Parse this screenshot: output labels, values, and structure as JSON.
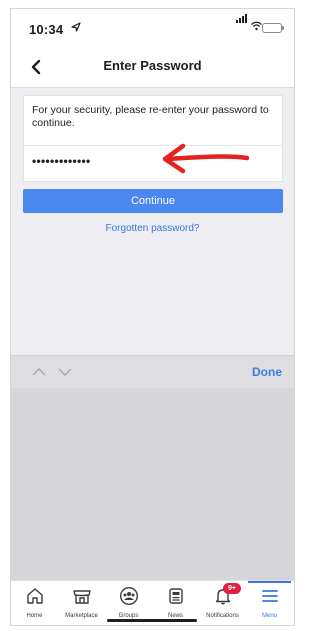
{
  "status_bar": {
    "time": "10:34"
  },
  "navbar": {
    "title": "Enter Password"
  },
  "form": {
    "message": "For your security, please re-enter your password to continue.",
    "password_value": "•••••••••••••",
    "continue_label": "Continue",
    "forgot_label": "Forgotten password?"
  },
  "keyboard_toolbar": {
    "done_label": "Done"
  },
  "tabbar": {
    "tabs": [
      {
        "label": "Home",
        "icon": "home-icon"
      },
      {
        "label": "Marketplace",
        "icon": "marketplace-icon"
      },
      {
        "label": "Groups",
        "icon": "groups-icon"
      },
      {
        "label": "News",
        "icon": "news-icon"
      },
      {
        "label": "Notifications",
        "icon": "bell-icon",
        "badge": "9+"
      },
      {
        "label": "Menu",
        "icon": "menu-icon",
        "active": true
      }
    ]
  },
  "colors": {
    "accent": "#4a88ef",
    "link": "#3878d6",
    "badge": "#e41e3f",
    "annotation_arrow": "#e3231f"
  }
}
